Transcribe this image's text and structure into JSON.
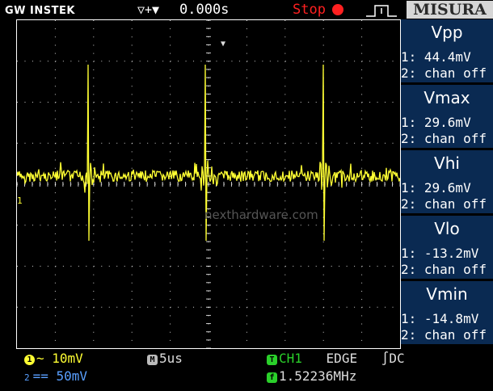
{
  "topbar": {
    "brand": "GW INSTEK",
    "trigger_icons": "▽+▼",
    "time_position": "0.000s",
    "run_state": "Stop",
    "menu_title": "MISURA"
  },
  "screen": {
    "ch1_marker": "1",
    "watermark": "nexthardware.com",
    "colors": {
      "trace": "#ffff33",
      "grid": "#ffffff",
      "panel": "#0a2a52"
    }
  },
  "measurements": [
    {
      "name": "Vpp",
      "ch1": "1: 44.4mV",
      "ch2": "2: chan off"
    },
    {
      "name": "Vmax",
      "ch1": "1: 29.6mV",
      "ch2": "2: chan off"
    },
    {
      "name": "Vhi",
      "ch1": "1: 29.6mV",
      "ch2": "2: chan off"
    },
    {
      "name": "Vlo",
      "ch1": "1: -13.2mV",
      "ch2": "2: chan off"
    },
    {
      "name": "Vmin",
      "ch1": "1: -14.8mV",
      "ch2": "2: chan off"
    }
  ],
  "status": {
    "ch1_badge": "1",
    "ch1_scale": "~ 10mV",
    "ch2_badge": "2",
    "ch2_scale": "== 50mV",
    "timebase_badge": "M",
    "timebase": "5us",
    "trigger_badge": "T",
    "trigger_source": "CH1",
    "trigger_type": "EDGE",
    "trigger_coupling": "∫DC",
    "freq_badge": "f",
    "frequency": "1.52236MHz"
  }
}
